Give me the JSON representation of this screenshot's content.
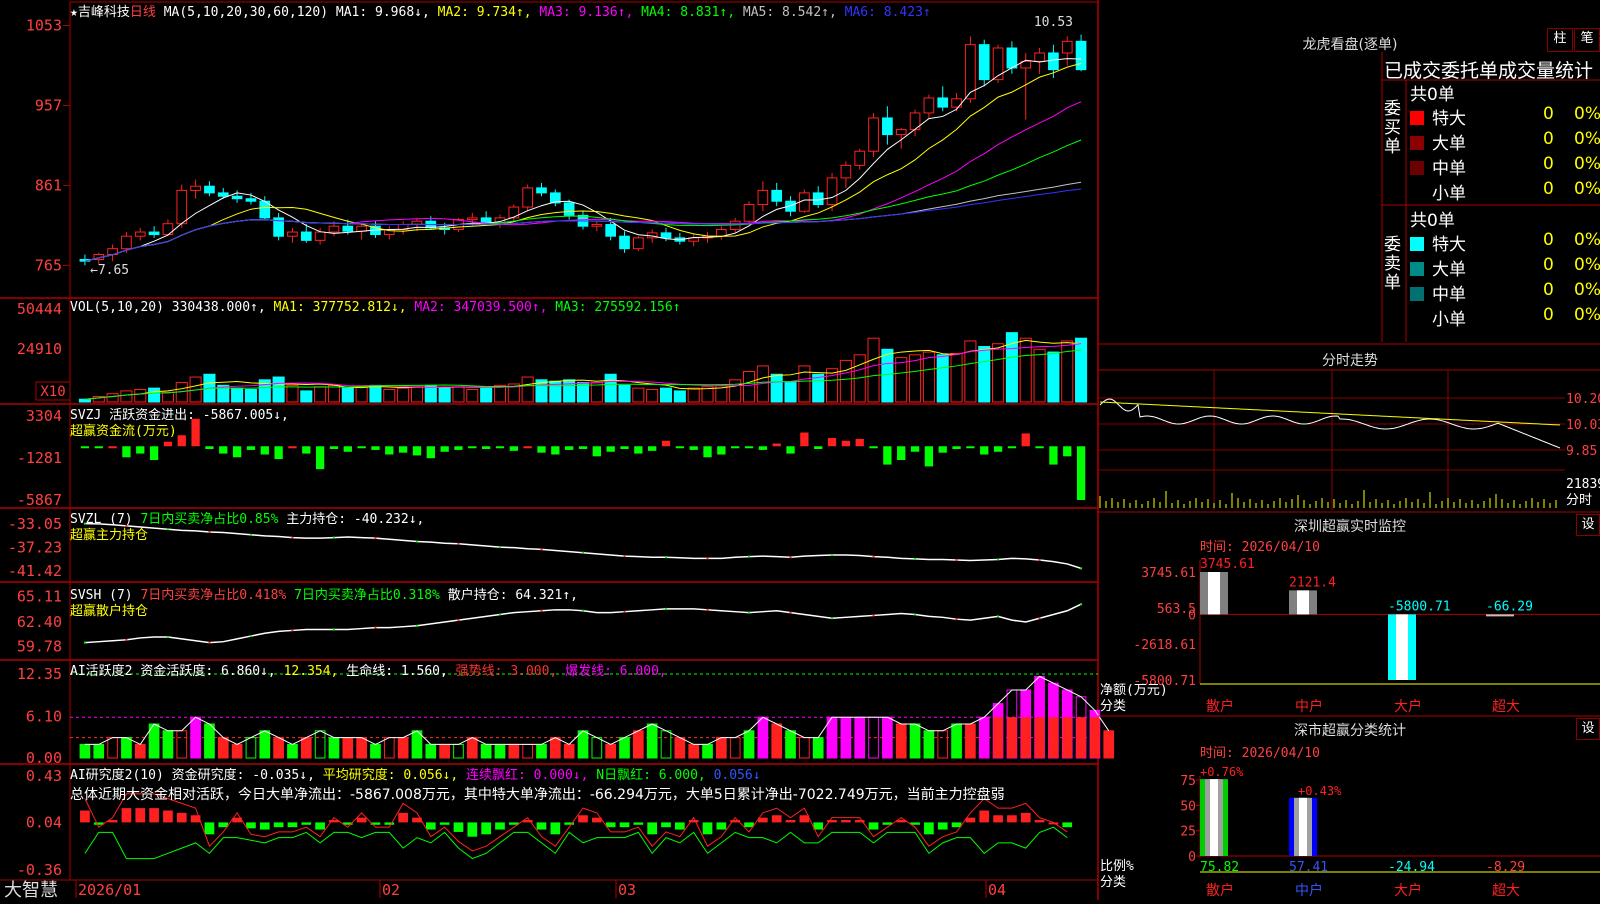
{
  "app": {
    "logo": "大智慧"
  },
  "stock": {
    "star": "★",
    "name": "吉峰科技",
    "period": "日线"
  },
  "main_header": {
    "ma_label": "MA(5,10,20,30,60,120)",
    "items": [
      {
        "text": "MA1: 9.968↓,",
        "color": "#ffffff"
      },
      {
        "text": "MA2: 9.734↑,",
        "color": "#ffff00"
      },
      {
        "text": "MA3: 9.136↑,",
        "color": "#ff00ff"
      },
      {
        "text": "MA4: 8.831↑,",
        "color": "#00ff00"
      },
      {
        "text": "MA5: 8.542↑,",
        "color": "#c0c0c0"
      },
      {
        "text": "MA6: 8.423↑",
        "color": "#3333ff"
      }
    ],
    "max_label": "10.53",
    "min_label": "←7.65"
  },
  "vol_header": {
    "label": "VOL(5,10,20)",
    "value": "330438.000↑,",
    "items": [
      {
        "text": "MA1: 377752.812↓,",
        "color": "#ffff00"
      },
      {
        "text": "MA2: 347039.500↑,",
        "color": "#ff00ff"
      },
      {
        "text": "MA3: 275592.156↑",
        "color": "#00ff00"
      }
    ],
    "unit": "X10"
  },
  "svzj_header": {
    "label": "SVZJ",
    "text": "活跃资金进出: -5867.005↓,",
    "sub": "超赢资金流(万元)"
  },
  "svzl_header": {
    "label": "SVZL (7)",
    "green_text": "7日内买卖净占比0.85%",
    "white_text": "主力持仓: -40.232↓,",
    "sub": "超赢主力持仓"
  },
  "svsh_header": {
    "label": "SVSH (7)",
    "red_text": "7日内买卖净占比0.418%",
    "green_text": "7日内买卖净占比0.318%",
    "white_text": "散户持仓: 64.321↑,",
    "sub": "超赢散户持仓"
  },
  "ai_active_header": {
    "label": "AI活跃度2",
    "text1": "资金活跃度: 6.860↓,",
    "text2": "12.354,",
    "text3": "生命线: 1.560,",
    "strong": "强势线: 3.000,",
    "burst": "爆发线: 6.000,"
  },
  "ai_research_header": {
    "label": "AI研究度2(10)",
    "text1": "资金研究度: -0.035↓,",
    "text2": "平均研究度: 0.056↓,",
    "text3": "连续飘红: 0.000↓,",
    "text4": "N日飘红: 6.000,",
    "text5": "0.056↓",
    "summary": "总体近期大资金相对活跃，今日大单净流出：-5867.008万元，其中特大单净流出：-66.294万元，大单5日累计净出-7022.749万元，当前主力控盘弱"
  },
  "date_axis": [
    "2026/01",
    "02",
    "03",
    "04"
  ],
  "right_panel": {
    "longhu": {
      "title": "龙虎看盘(逐单)",
      "btn1": "柱",
      "btn2": "笔",
      "tab_text": "已成交委托单成交量统计",
      "buy_label": "委买单",
      "sell_label": "委卖单",
      "buy_total": "共0单",
      "sell_total": "共0单",
      "buy_rows": [
        {
          "label": "特大",
          "count": "0",
          "pct": "0%",
          "color": "#ff0000"
        },
        {
          "label": "大单",
          "count": "0",
          "pct": "0%",
          "color": "#8b0000"
        },
        {
          "label": "中单",
          "count": "0",
          "pct": "0%",
          "color": "#6b0000"
        },
        {
          "label": "小单",
          "count": "0",
          "pct": "0%",
          "color": ""
        }
      ],
      "sell_rows": [
        {
          "label": "特大",
          "count": "0",
          "pct": "0%",
          "color": "#00ffff"
        },
        {
          "label": "大单",
          "count": "0",
          "pct": "0%",
          "color": "#008b8b"
        },
        {
          "label": "中单",
          "count": "0",
          "pct": "0%",
          "color": "#007070"
        },
        {
          "label": "小单",
          "count": "0",
          "pct": "0%",
          "color": ""
        }
      ]
    },
    "intraday": {
      "title": "分时走势",
      "prices": [
        "10.20",
        "10.03",
        "9.85"
      ],
      "vol_label": "21839",
      "vol_unit": "分时"
    },
    "sz_monitor": {
      "title": "深圳超赢实时监控",
      "set_btn": "设",
      "time": "时间: 2026/04/10",
      "y_ticks": [
        "3745.61",
        "563.5",
        "0",
        "-2618.61",
        "-5800.71"
      ],
      "y_unit": "净额(万元)",
      "x_unit": "分类",
      "categories": [
        "散户",
        "中户",
        "大户",
        "超大"
      ],
      "values": [
        3745.61,
        2121.4,
        -5800.71,
        -66.29
      ],
      "value_labels": [
        "3745.61",
        "2121.4",
        "-5800.71",
        "-66.29"
      ]
    },
    "sh_stats": {
      "title": "深市超赢分类统计",
      "set_btn": "设",
      "time": "时间: 2026/04/10",
      "y_ticks": [
        "75",
        "50",
        "25",
        "0"
      ],
      "y_unit": "比例%",
      "x_unit": "分类",
      "categories": [
        "散户",
        "中户",
        "大户",
        "超大"
      ],
      "changes": [
        "+0.76%",
        "+0.43%"
      ],
      "values": [
        75.82,
        57.41,
        -24.94,
        -8.29
      ],
      "value_labels": [
        "75.82",
        "57.41",
        "-24.94",
        "-8.29"
      ]
    }
  },
  "colors": {
    "up": "#ff2020",
    "down": "#00ffff",
    "grid": "#b00000",
    "axis_text": "#ff4040"
  },
  "chart_data": [
    {
      "type": "candlestick",
      "title": "吉峰科技 日线",
      "y_ticks": [
        "10.53",
        "9.57",
        "8.61",
        "7.65"
      ],
      "ylim": [
        7.45,
        10.62
      ],
      "x_labels": [
        "2026/01",
        "02",
        "03",
        "04"
      ],
      "series": [
        {
          "o": 7.72,
          "h": 7.78,
          "l": 7.65,
          "c": 7.7
        },
        {
          "o": 7.72,
          "h": 7.8,
          "l": 7.66,
          "c": 7.78
        },
        {
          "o": 7.78,
          "h": 7.9,
          "l": 7.7,
          "c": 7.85
        },
        {
          "o": 7.85,
          "h": 8.05,
          "l": 7.8,
          "c": 8.0
        },
        {
          "o": 8.0,
          "h": 8.1,
          "l": 7.95,
          "c": 8.05
        },
        {
          "o": 8.05,
          "h": 8.12,
          "l": 7.98,
          "c": 8.02
        },
        {
          "o": 8.02,
          "h": 8.2,
          "l": 8.0,
          "c": 8.15
        },
        {
          "o": 8.15,
          "h": 8.62,
          "l": 8.1,
          "c": 8.55
        },
        {
          "o": 8.55,
          "h": 8.68,
          "l": 8.45,
          "c": 8.6
        },
        {
          "o": 8.6,
          "h": 8.66,
          "l": 8.48,
          "c": 8.52
        },
        {
          "o": 8.52,
          "h": 8.58,
          "l": 8.45,
          "c": 8.48
        },
        {
          "o": 8.48,
          "h": 8.55,
          "l": 8.4,
          "c": 8.45
        },
        {
          "o": 8.45,
          "h": 8.52,
          "l": 8.38,
          "c": 8.42
        },
        {
          "o": 8.42,
          "h": 8.48,
          "l": 8.2,
          "c": 8.22
        },
        {
          "o": 8.22,
          "h": 8.28,
          "l": 7.95,
          "c": 8.0
        },
        {
          "o": 8.0,
          "h": 8.1,
          "l": 7.92,
          "c": 8.05
        },
        {
          "o": 8.05,
          "h": 8.15,
          "l": 7.92,
          "c": 7.95
        },
        {
          "o": 7.95,
          "h": 8.1,
          "l": 7.9,
          "c": 8.05
        },
        {
          "o": 8.05,
          "h": 8.18,
          "l": 8.0,
          "c": 8.12
        },
        {
          "o": 8.12,
          "h": 8.2,
          "l": 8.02,
          "c": 8.06
        },
        {
          "o": 8.06,
          "h": 8.16,
          "l": 7.96,
          "c": 8.12
        },
        {
          "o": 8.12,
          "h": 8.18,
          "l": 7.98,
          "c": 8.02
        },
        {
          "o": 8.02,
          "h": 8.12,
          "l": 7.96,
          "c": 8.08
        },
        {
          "o": 8.08,
          "h": 8.18,
          "l": 8.02,
          "c": 8.14
        },
        {
          "o": 8.14,
          "h": 8.22,
          "l": 8.06,
          "c": 8.18
        },
        {
          "o": 8.18,
          "h": 8.24,
          "l": 8.08,
          "c": 8.1
        },
        {
          "o": 8.1,
          "h": 8.16,
          "l": 8.02,
          "c": 8.08
        },
        {
          "o": 8.08,
          "h": 8.22,
          "l": 8.05,
          "c": 8.2
        },
        {
          "o": 8.2,
          "h": 8.28,
          "l": 8.12,
          "c": 8.22
        },
        {
          "o": 8.22,
          "h": 8.3,
          "l": 8.14,
          "c": 8.16
        },
        {
          "o": 8.16,
          "h": 8.26,
          "l": 8.1,
          "c": 8.22
        },
        {
          "o": 8.22,
          "h": 8.38,
          "l": 8.18,
          "c": 8.35
        },
        {
          "o": 8.35,
          "h": 8.62,
          "l": 8.3,
          "c": 8.58
        },
        {
          "o": 8.58,
          "h": 8.64,
          "l": 8.48,
          "c": 8.52
        },
        {
          "o": 8.52,
          "h": 8.56,
          "l": 8.36,
          "c": 8.4
        },
        {
          "o": 8.4,
          "h": 8.44,
          "l": 8.2,
          "c": 8.25
        },
        {
          "o": 8.25,
          "h": 8.3,
          "l": 8.08,
          "c": 8.12
        },
        {
          "o": 8.12,
          "h": 8.18,
          "l": 8.06,
          "c": 8.14
        },
        {
          "o": 8.14,
          "h": 8.22,
          "l": 7.95,
          "c": 8.0
        },
        {
          "o": 8.0,
          "h": 8.06,
          "l": 7.8,
          "c": 7.85
        },
        {
          "o": 7.85,
          "h": 8.0,
          "l": 7.82,
          "c": 7.98
        },
        {
          "o": 7.98,
          "h": 8.08,
          "l": 7.92,
          "c": 8.04
        },
        {
          "o": 8.04,
          "h": 8.1,
          "l": 7.94,
          "c": 7.98
        },
        {
          "o": 7.98,
          "h": 8.04,
          "l": 7.9,
          "c": 7.94
        },
        {
          "o": 7.94,
          "h": 8.02,
          "l": 7.88,
          "c": 7.98
        },
        {
          "o": 7.98,
          "h": 8.05,
          "l": 7.92,
          "c": 8.0
        },
        {
          "o": 8.0,
          "h": 8.12,
          "l": 7.96,
          "c": 8.08
        },
        {
          "o": 8.08,
          "h": 8.22,
          "l": 8.04,
          "c": 8.18
        },
        {
          "o": 8.18,
          "h": 8.42,
          "l": 8.14,
          "c": 8.38
        },
        {
          "o": 8.38,
          "h": 8.66,
          "l": 8.3,
          "c": 8.55
        },
        {
          "o": 8.55,
          "h": 8.64,
          "l": 8.36,
          "c": 8.42
        },
        {
          "o": 8.42,
          "h": 8.48,
          "l": 8.24,
          "c": 8.3
        },
        {
          "o": 8.3,
          "h": 8.56,
          "l": 8.28,
          "c": 8.52
        },
        {
          "o": 8.52,
          "h": 8.6,
          "l": 8.34,
          "c": 8.38
        },
        {
          "o": 8.38,
          "h": 8.76,
          "l": 8.3,
          "c": 8.7
        },
        {
          "o": 8.7,
          "h": 8.9,
          "l": 8.58,
          "c": 8.85
        },
        {
          "o": 8.85,
          "h": 9.05,
          "l": 8.8,
          "c": 9.02
        },
        {
          "o": 9.02,
          "h": 9.48,
          "l": 8.95,
          "c": 9.42
        },
        {
          "o": 9.42,
          "h": 9.56,
          "l": 9.1,
          "c": 9.22
        },
        {
          "o": 9.22,
          "h": 9.3,
          "l": 9.05,
          "c": 9.28
        },
        {
          "o": 9.28,
          "h": 9.52,
          "l": 9.2,
          "c": 9.48
        },
        {
          "o": 9.48,
          "h": 9.7,
          "l": 9.42,
          "c": 9.66
        },
        {
          "o": 9.66,
          "h": 9.8,
          "l": 9.5,
          "c": 9.55
        },
        {
          "o": 9.55,
          "h": 9.72,
          "l": 9.5,
          "c": 9.65
        },
        {
          "o": 9.65,
          "h": 10.4,
          "l": 9.6,
          "c": 10.3
        },
        {
          "o": 10.3,
          "h": 10.36,
          "l": 9.8,
          "c": 9.88
        },
        {
          "o": 9.88,
          "h": 10.3,
          "l": 9.84,
          "c": 10.26
        },
        {
          "o": 10.26,
          "h": 10.34,
          "l": 9.95,
          "c": 10.02
        },
        {
          "o": 10.02,
          "h": 10.2,
          "l": 9.4,
          "c": 10.1
        },
        {
          "o": 10.1,
          "h": 10.26,
          "l": 9.95,
          "c": 10.2
        },
        {
          "o": 10.2,
          "h": 10.3,
          "l": 9.9,
          "c": 10.0
        },
        {
          "o": 10.2,
          "h": 10.4,
          "l": 10.05,
          "c": 10.34
        },
        {
          "o": 10.34,
          "h": 10.42,
          "l": 9.98,
          "c": 10.0
        }
      ]
    },
    {
      "type": "bar",
      "title": "VOL(5,10,20)",
      "y_ticks": [
        "50444",
        "24910"
      ],
      "unit": "X10",
      "values": [
        2,
        4,
        6,
        8,
        9,
        10,
        7,
        14,
        18,
        20,
        12,
        10,
        9,
        16,
        18,
        12,
        8,
        11,
        12,
        10,
        11,
        12,
        9,
        10,
        11,
        12,
        10,
        11,
        9,
        11,
        12,
        13,
        18,
        16,
        15,
        16,
        14,
        14,
        20,
        12,
        10,
        9,
        10,
        8,
        10,
        11,
        12,
        16,
        22,
        26,
        20,
        14,
        26,
        20,
        24,
        30,
        34,
        46,
        38,
        32,
        34,
        36,
        34,
        35,
        44,
        40,
        42,
        50,
        46,
        38,
        36,
        44,
        46
      ],
      "ylim": [
        0,
        62
      ]
    },
    {
      "type": "bar",
      "title": "SVZJ 超赢资金流(万元)",
      "y_ticks": [
        "3304",
        "-1281",
        "-5867"
      ],
      "ylim": [
        -5867,
        3304
      ],
      "values": [
        -200,
        -100,
        0,
        -1200,
        -800,
        -1500,
        500,
        1200,
        3000,
        -300,
        -800,
        -1200,
        -400,
        -900,
        -1400,
        0,
        -800,
        -2500,
        -300,
        -600,
        -100,
        -400,
        -900,
        -700,
        -1000,
        -1300,
        -600,
        -400,
        -200,
        -300,
        -100,
        -500,
        0,
        -700,
        -900,
        -400,
        -300,
        -1100,
        -600,
        -300,
        -800,
        -500,
        600,
        -100,
        -400,
        -1200,
        -900,
        -200,
        -100,
        -400,
        300,
        -800,
        1500,
        -300,
        900,
        600,
        800,
        -200,
        -2000,
        -1500,
        -600,
        -2200,
        -700,
        -300,
        -200,
        -900,
        -600,
        -200,
        1400,
        -100,
        -2000,
        -1100,
        -5867
      ]
    },
    {
      "type": "line",
      "title": "SVZL (7) 超赢主力持仓",
      "y_ticks": [
        "-33.05",
        "-37.23",
        "-41.42"
      ],
      "ylim": [
        -42.0,
        -32.0
      ],
      "values": [
        -33.0,
        -33.05,
        -33.2,
        -33.4,
        -33.6,
        -33.8,
        -34.0,
        -34.2,
        -34.3,
        -34.5,
        -34.6,
        -34.8,
        -35.0,
        -35.2,
        -35.3,
        -35.5,
        -35.6,
        -35.6,
        -35.5,
        -35.4,
        -35.5,
        -35.6,
        -35.8,
        -36.0,
        -36.2,
        -36.3,
        -36.5,
        -36.6,
        -36.8,
        -37.0,
        -37.2,
        -37.3,
        -37.5,
        -37.6,
        -37.8,
        -38.0,
        -38.2,
        -38.4,
        -38.6,
        -38.8,
        -38.9,
        -39.0,
        -39.0,
        -39.1,
        -39.2,
        -39.2,
        -39.2,
        -39.0,
        -38.9,
        -38.8,
        -38.9,
        -39.0,
        -38.8,
        -38.7,
        -38.6,
        -38.6,
        -38.7,
        -38.9,
        -39.0,
        -39.2,
        -39.3,
        -39.4,
        -39.4,
        -39.5,
        -39.6,
        -39.5,
        -39.4,
        -39.2,
        -39.3,
        -39.5,
        -39.8,
        -40.2,
        -41.0
      ]
    },
    {
      "type": "line",
      "title": "SVSH (7) 超赢散户持仓",
      "y_ticks": [
        "65.11",
        "62.40",
        "59.78"
      ],
      "ylim": [
        59.2,
        65.6
      ],
      "values": [
        60.2,
        60.3,
        60.4,
        60.5,
        60.7,
        60.8,
        60.8,
        60.6,
        60.4,
        60.2,
        60.3,
        60.6,
        60.9,
        61.2,
        61.4,
        61.5,
        61.6,
        61.6,
        61.6,
        61.6,
        61.7,
        61.8,
        61.8,
        61.9,
        62.0,
        62.2,
        62.4,
        62.6,
        62.8,
        63.0,
        63.2,
        63.4,
        63.5,
        63.6,
        63.7,
        63.7,
        63.6,
        63.4,
        63.4,
        63.5,
        63.6,
        63.7,
        63.8,
        63.8,
        63.8,
        63.7,
        63.6,
        63.5,
        63.4,
        63.5,
        63.6,
        63.4,
        63.2,
        63.0,
        62.8,
        62.9,
        63.0,
        63.1,
        63.2,
        63.3,
        63.2,
        63.0,
        62.9,
        62.7,
        62.6,
        62.8,
        63.0,
        62.6,
        62.4,
        62.8,
        63.2,
        63.6,
        64.3
      ]
    },
    {
      "type": "bar",
      "title": "AI活跃度2",
      "y_ticks": [
        "12.35",
        "6.10",
        "0.00"
      ],
      "ylim": [
        0,
        12.35
      ],
      "lines": {
        "strong": 3.0,
        "burst": 6.0
      },
      "values": [
        2,
        2,
        3,
        3,
        2,
        5,
        4,
        4,
        6,
        5,
        3,
        2,
        3,
        4,
        3,
        2,
        3,
        4,
        3,
        3,
        3,
        2,
        3,
        3,
        4,
        2,
        2,
        2,
        3,
        2,
        2,
        2,
        2,
        2,
        3,
        2,
        4,
        3,
        2,
        3,
        4,
        5,
        4,
        3,
        2,
        2,
        3,
        3,
        4,
        6,
        5,
        4,
        3,
        3,
        6,
        6,
        6,
        6,
        6,
        5,
        5,
        4,
        4,
        5,
        5,
        6,
        8,
        10,
        10,
        12,
        11,
        10,
        9,
        7,
        4
      ]
    },
    {
      "type": "bar",
      "title": "AI研究度2(10)",
      "y_ticks": [
        "0.43",
        "0.04",
        "-0.36"
      ],
      "ylim": [
        -0.36,
        0.43
      ],
      "values": [
        0.1,
        -0.02,
        0.02,
        0.12,
        0.12,
        0.12,
        0.1,
        0.08,
        0.06,
        -0.1,
        -0.04,
        0.04,
        -0.05,
        -0.06,
        -0.04,
        -0.04,
        -0.02,
        -0.06,
        0.02,
        -0.02,
        0.04,
        -0.02,
        -0.02,
        0.08,
        0.04,
        -0.06,
        -0.02,
        -0.08,
        -0.12,
        -0.1,
        -0.06,
        -0.02,
        0.02,
        -0.06,
        -0.1,
        -0.02,
        0.06,
        0.04,
        -0.04,
        -0.04,
        -0.02,
        -0.1,
        -0.04,
        -0.06,
        0.02,
        -0.1,
        -0.06,
        0.02,
        -0.04,
        0.04,
        0.06,
        0.02,
        0.06,
        -0.06,
        0.02,
        0.02,
        0.02,
        -0.06,
        -0.02,
        0.02,
        -0.02,
        -0.1,
        -0.06,
        -0.04,
        0.04,
        0.1,
        0.06,
        0.06,
        0.08,
        0.02,
        0.0,
        -0.04
      ]
    }
  ]
}
